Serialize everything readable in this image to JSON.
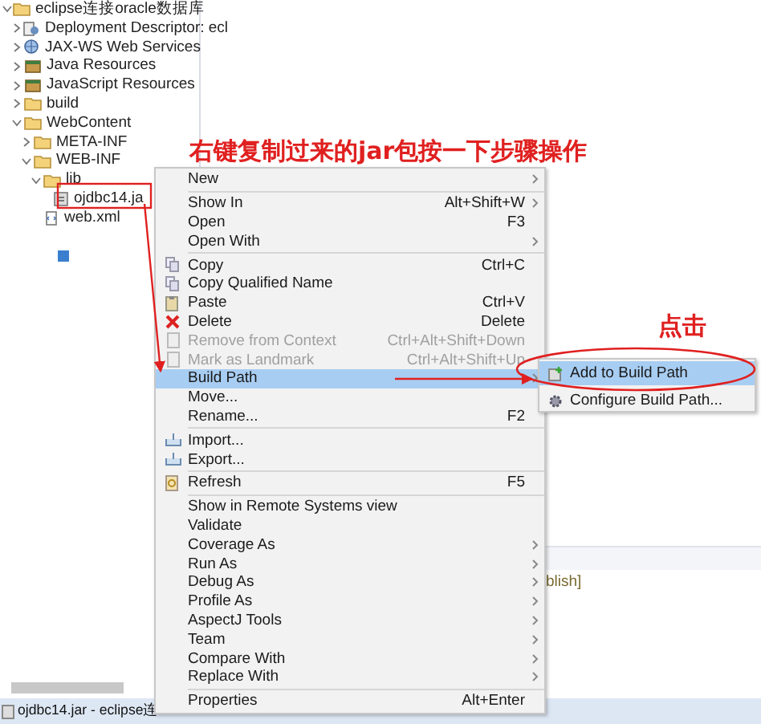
{
  "tree": [
    {
      "label": "eclipse连接oracle数据库",
      "kind": "project",
      "expanded": true,
      "children": [
        {
          "label": "Deployment Descriptor: ecl",
          "kind": "descriptor",
          "expanded": false
        },
        {
          "label": "JAX-WS Web Services",
          "kind": "services",
          "expanded": false
        },
        {
          "label": "Java Resources",
          "kind": "resources",
          "expanded": false
        },
        {
          "label": "JavaScript Resources",
          "kind": "resources",
          "expanded": false
        },
        {
          "label": "build",
          "kind": "folder",
          "expanded": false
        },
        {
          "label": "WebContent",
          "kind": "folder",
          "expanded": true,
          "children": [
            {
              "label": "META-INF",
              "kind": "folder",
              "expanded": false
            },
            {
              "label": "WEB-INF",
              "kind": "folder",
              "expanded": true,
              "children": [
                {
                  "label": "lib",
                  "kind": "folder",
                  "expanded": true,
                  "children": [
                    {
                      "label": "ojdbc14.ja",
                      "kind": "jar"
                    }
                  ]
                },
                {
                  "label": "web.xml",
                  "kind": "xml"
                }
              ]
            }
          ]
        }
      ]
    }
  ],
  "context_menu": {
    "groups": [
      [
        {
          "label": "New",
          "submenu": true,
          "disabled": false,
          "selected": false
        }
      ],
      [
        {
          "label": "Show In",
          "shortcut": "Alt+Shift+W",
          "submenu": true,
          "disabled": false,
          "selected": false
        },
        {
          "label": "Open",
          "shortcut": "F3",
          "submenu": false,
          "disabled": false,
          "selected": false
        },
        {
          "label": "Open With",
          "submenu": true,
          "disabled": false,
          "selected": false
        }
      ],
      [
        {
          "label": "Copy",
          "shortcut": "Ctrl+C",
          "submenu": false,
          "disabled": false,
          "selected": false
        },
        {
          "label": "Copy Qualified Name",
          "submenu": false,
          "disabled": false,
          "selected": false
        },
        {
          "label": "Paste",
          "shortcut": "Ctrl+V",
          "submenu": false,
          "disabled": false,
          "selected": false
        },
        {
          "label": "Delete",
          "shortcut": "Delete",
          "submenu": false,
          "disabled": false,
          "selected": false
        },
        {
          "label": "Remove from Context",
          "shortcut": "Ctrl+Alt+Shift+Down",
          "submenu": false,
          "disabled": true,
          "selected": false
        },
        {
          "label": "Mark as Landmark",
          "shortcut": "Ctrl+Alt+Shift+Up",
          "submenu": false,
          "disabled": true,
          "selected": false
        },
        {
          "label": "Build Path",
          "submenu": true,
          "disabled": false,
          "selected": true
        },
        {
          "label": "Move...",
          "submenu": false,
          "disabled": false,
          "selected": false
        },
        {
          "label": "Rename...",
          "shortcut": "F2",
          "submenu": false,
          "disabled": false,
          "selected": false
        }
      ],
      [
        {
          "label": "Import...",
          "submenu": false,
          "disabled": false,
          "selected": false
        },
        {
          "label": "Export...",
          "submenu": false,
          "disabled": false,
          "selected": false
        }
      ],
      [
        {
          "label": "Refresh",
          "shortcut": "F5",
          "submenu": false,
          "disabled": false,
          "selected": false
        }
      ],
      [
        {
          "label": "Show in Remote Systems view",
          "submenu": false,
          "disabled": false,
          "selected": false
        },
        {
          "label": "Validate",
          "submenu": false,
          "disabled": false,
          "selected": false
        },
        {
          "label": "Coverage As",
          "submenu": true,
          "disabled": false,
          "selected": false
        },
        {
          "label": "Run As",
          "submenu": true,
          "disabled": false,
          "selected": false
        },
        {
          "label": "Debug As",
          "submenu": true,
          "disabled": false,
          "selected": false
        },
        {
          "label": "Profile As",
          "submenu": true,
          "disabled": false,
          "selected": false
        },
        {
          "label": "AspectJ Tools",
          "submenu": true,
          "disabled": false,
          "selected": false
        },
        {
          "label": "Team",
          "submenu": true,
          "disabled": false,
          "selected": false
        },
        {
          "label": "Compare With",
          "submenu": true,
          "disabled": false,
          "selected": false
        },
        {
          "label": "Replace With",
          "submenu": true,
          "disabled": false,
          "selected": false
        }
      ],
      [
        {
          "label": "Properties",
          "shortcut": "Alt+Enter",
          "submenu": false,
          "disabled": false,
          "selected": false
        }
      ]
    ]
  },
  "submenu": {
    "items": [
      {
        "label": "Add to Build Path",
        "selected": true
      },
      {
        "label": "Configure Build Path...",
        "selected": false
      }
    ]
  },
  "annotations": {
    "instruction": "右键复制过来的jar包按一下步骤操作",
    "click_note": "点击"
  },
  "editor": {
    "text": "blish]"
  },
  "status_bar": {
    "text": "ojdbc14.jar - eclipse连"
  }
}
